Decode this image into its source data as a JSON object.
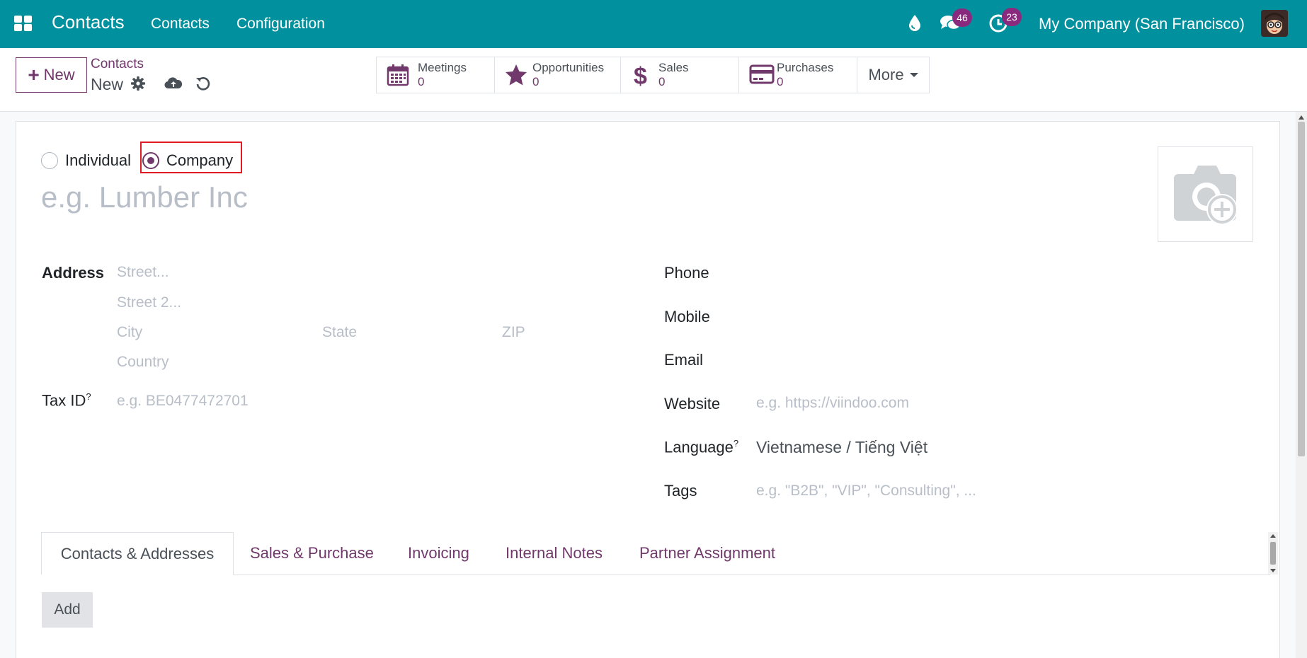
{
  "navbar": {
    "app_title": "Contacts",
    "menu": [
      "Contacts",
      "Configuration"
    ],
    "messages_count": "46",
    "activities_count": "23",
    "company": "My Company (San Francisco)"
  },
  "control_panel": {
    "new_label": "New",
    "breadcrumb_parent": "Contacts",
    "breadcrumb_current": "New",
    "smart_buttons": [
      {
        "label": "Meetings",
        "value": "0",
        "icon": "calendar-icon"
      },
      {
        "label": "Opportunities",
        "value": "0",
        "icon": "star-icon"
      },
      {
        "label": "Sales",
        "value": "0",
        "icon": "dollar-icon"
      },
      {
        "label": "Purchases",
        "value": "0",
        "icon": "credit-card-icon"
      }
    ],
    "more_label": "More"
  },
  "form": {
    "type_options": [
      "Individual",
      "Company"
    ],
    "selected_type": "Company",
    "name_placeholder": "e.g. Lumber Inc",
    "address_label": "Address",
    "street_placeholder": "Street...",
    "street2_placeholder": "Street 2...",
    "city_placeholder": "City",
    "state_placeholder": "State",
    "zip_placeholder": "ZIP",
    "country_placeholder": "Country",
    "tax_id_label": "Tax ID",
    "tax_id_tooltip": "?",
    "tax_id_placeholder": "e.g. BE0477472701",
    "phone_label": "Phone",
    "mobile_label": "Mobile",
    "email_label": "Email",
    "website_label": "Website",
    "website_placeholder": "e.g. https://viindoo.com",
    "language_label": "Language",
    "language_tooltip": "?",
    "language_value": "Vietnamese / Tiếng Việt",
    "tags_label": "Tags",
    "tags_placeholder": "e.g. \"B2B\", \"VIP\", \"Consulting\", ..."
  },
  "tabs": [
    {
      "label": "Contacts & Addresses",
      "active": true
    },
    {
      "label": "Sales & Purchase",
      "active": false
    },
    {
      "label": "Invoicing",
      "active": false
    },
    {
      "label": "Internal Notes",
      "active": false
    },
    {
      "label": "Partner Assignment",
      "active": false
    }
  ],
  "add_label": "Add",
  "colors": {
    "navbar": "#01909d",
    "primary": "#71396b",
    "badge": "#8a2a7e",
    "highlight": "#e01b24"
  }
}
